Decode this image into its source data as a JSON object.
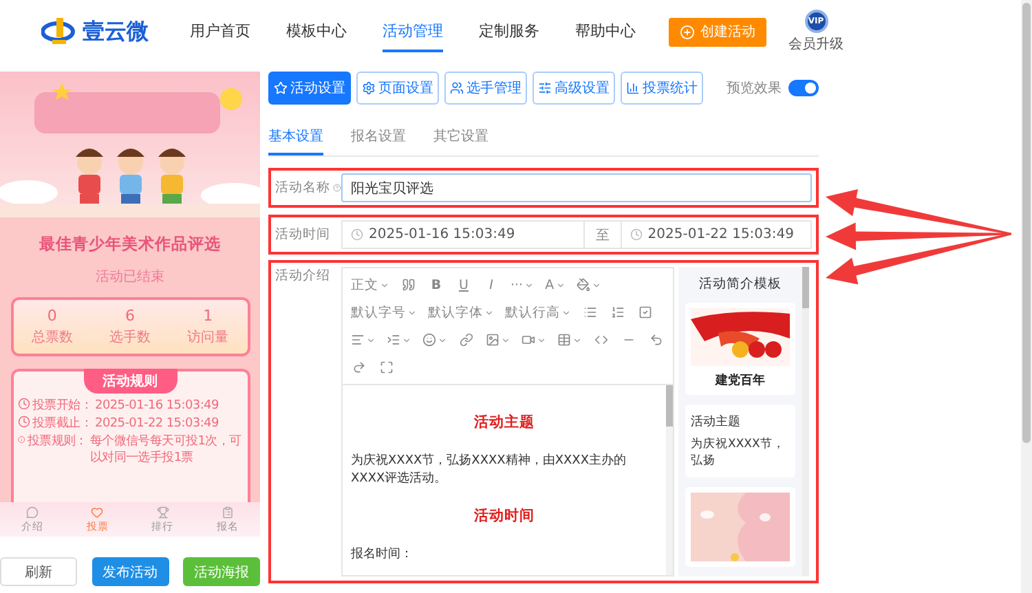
{
  "nav": {
    "brand": "壹云微",
    "items": [
      {
        "label": "用户首页",
        "selected": false
      },
      {
        "label": "模板中心",
        "selected": false
      },
      {
        "label": "活动管理",
        "selected": true
      },
      {
        "label": "定制服务",
        "selected": false
      },
      {
        "label": "帮助中心",
        "selected": false
      }
    ],
    "create_button": "创建活动",
    "vip": {
      "badge": "VIP",
      "label": "会员升级"
    }
  },
  "preview": {
    "subtitle": "最佳青少年美术作品评选",
    "status": "活动已结束",
    "stats": [
      {
        "value": "0",
        "label": "总票数"
      },
      {
        "value": "6",
        "label": "选手数"
      },
      {
        "value": "1",
        "label": "访问量"
      }
    ],
    "rules": {
      "title": "活动规则",
      "items": [
        {
          "kind": "clock",
          "label": "投票开始：",
          "value": "2025-01-16 15:03:49"
        },
        {
          "kind": "clock",
          "label": "投票截止：",
          "value": "2025-01-22 15:03:49"
        },
        {
          "kind": "info",
          "label": "投票规则：",
          "value": "每个微信号每天可投1次，可以对同一选手投1票"
        }
      ]
    },
    "tabbar": [
      {
        "label": "介绍",
        "selected": false
      },
      {
        "label": "投票",
        "selected": true
      },
      {
        "label": "排行",
        "selected": false
      },
      {
        "label": "报名",
        "selected": false
      }
    ]
  },
  "preview_actions": [
    {
      "label": "刷新",
      "kind": "plain"
    },
    {
      "label": "发布活动",
      "kind": "primary"
    },
    {
      "label": "活动海报",
      "kind": "success"
    }
  ],
  "section_buttons": [
    {
      "label": "活动设置",
      "selected": true
    },
    {
      "label": "页面设置",
      "selected": false
    },
    {
      "label": "选手管理",
      "selected": false
    },
    {
      "label": "高级设置",
      "selected": false
    },
    {
      "label": "投票统计",
      "selected": false
    }
  ],
  "preview_toggle": {
    "label": "预览效果",
    "on": true
  },
  "tabs": [
    {
      "label": "基本设置",
      "selected": true
    },
    {
      "label": "报名设置",
      "selected": false
    },
    {
      "label": "其它设置",
      "selected": false
    }
  ],
  "form": {
    "name": {
      "label": "活动名称",
      "value": "阳光宝贝评选",
      "annotated": true
    },
    "time": {
      "label": "活动时间",
      "start": "2025-01-16 15:03:49",
      "separator": "至",
      "end": "2025-01-22 15:03:49",
      "annotated": true
    },
    "intro": {
      "label": "活动介绍",
      "annotated": true,
      "toolbar": [
        {
          "kind": "dropdown",
          "label": "正文"
        },
        {
          "kind": "icon"
        },
        {
          "kind": "glyph",
          "label": "B"
        },
        {
          "kind": "glyph",
          "label": "U"
        },
        {
          "kind": "glyph",
          "label": "I"
        },
        {
          "kind": "dropdown",
          "label": "···"
        },
        {
          "kind": "dropdown",
          "label": "A"
        },
        {
          "kind": "icon_menu"
        },
        {
          "kind": "dropdown",
          "label": "默认字号"
        },
        {
          "kind": "dropdown",
          "label": "默认字体"
        },
        {
          "kind": "dropdown",
          "label": "默认行高"
        },
        {
          "kind": "icon"
        },
        {
          "kind": "icon"
        },
        {
          "kind": "icon"
        },
        {
          "kind": "icon_menu"
        },
        {
          "kind": "icon_menu"
        },
        {
          "kind": "icon_menu"
        },
        {
          "kind": "icon"
        },
        {
          "kind": "icon_menu"
        },
        {
          "kind": "icon_menu"
        },
        {
          "kind": "icon_menu"
        },
        {
          "kind": "icon"
        },
        {
          "kind": "icon"
        },
        {
          "kind": "icon"
        },
        {
          "kind": "icon"
        },
        {
          "kind": "icon"
        }
      ],
      "content": [
        {
          "kind": "heading",
          "text": "活动主题"
        },
        {
          "kind": "paragraph",
          "text": "为庆祝XXXX节，弘扬XXXX精神，由XXXX主办的XXXX评选活动。"
        },
        {
          "kind": "heading",
          "text": "活动时间"
        },
        {
          "kind": "paragraph",
          "text": "报名时间："
        }
      ],
      "templates": {
        "title": "活动简介模板",
        "cards": [
          {
            "kind": "picture",
            "caption": "建党百年"
          },
          {
            "kind": "text",
            "heading": "活动主题",
            "text": "为庆祝XXXX节，弘扬"
          },
          {
            "kind": "picture"
          }
        ]
      }
    }
  }
}
